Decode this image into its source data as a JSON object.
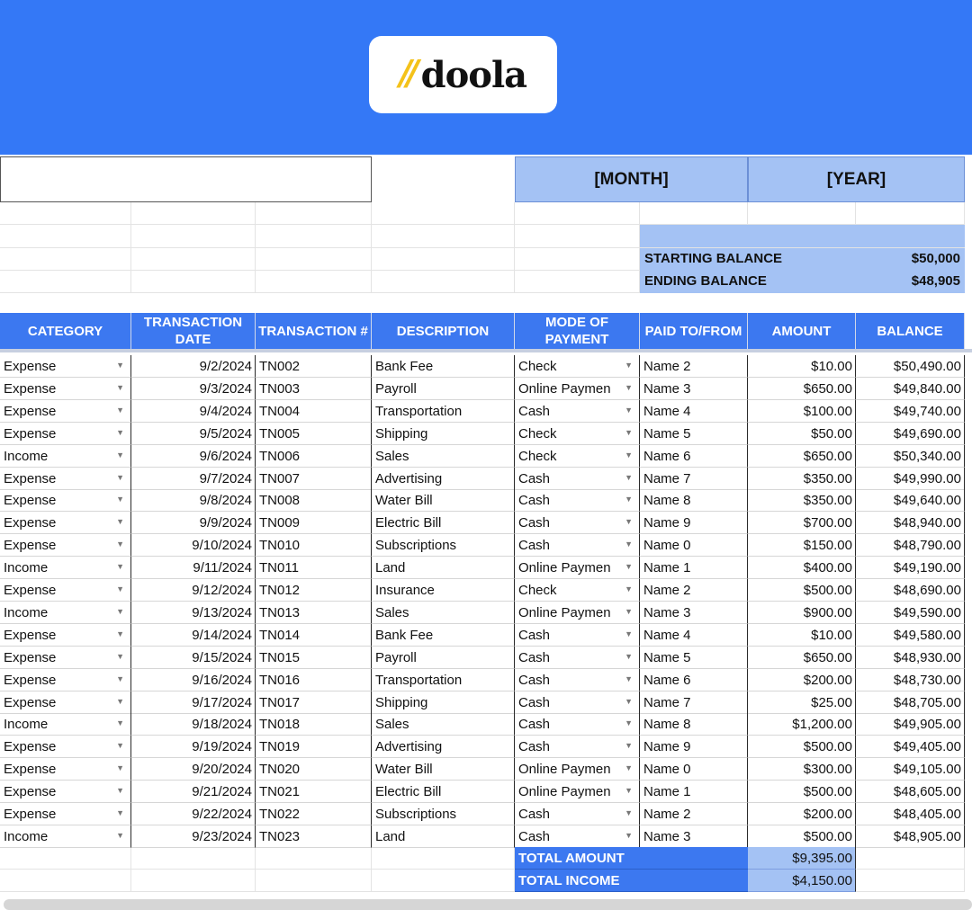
{
  "logo": {
    "slash": "//",
    "name": "doola"
  },
  "header": {
    "month_label": "[MONTH]",
    "year_label": "[YEAR]"
  },
  "balance": {
    "starting_label": "STARTING BALANCE",
    "starting_value": "$50,000",
    "ending_label": "ENDING BALANCE",
    "ending_value": "$48,905"
  },
  "columns": [
    "CATEGORY",
    "TRANSACTION DATE",
    "TRANSACTION #",
    "DESCRIPTION",
    "MODE OF PAYMENT",
    "PAID TO/FROM",
    "AMOUNT",
    "BALANCE"
  ],
  "rows": [
    [
      "Expense",
      "9/2/2024",
      "TN002",
      "Bank Fee",
      "Check",
      "Name 2",
      "$10.00",
      "$50,490.00"
    ],
    [
      "Expense",
      "9/3/2024",
      "TN003",
      "Payroll",
      "Online Paymen",
      "Name 3",
      "$650.00",
      "$49,840.00"
    ],
    [
      "Expense",
      "9/4/2024",
      "TN004",
      "Transportation",
      "Cash",
      "Name 4",
      "$100.00",
      "$49,740.00"
    ],
    [
      "Expense",
      "9/5/2024",
      "TN005",
      "Shipping",
      "Check",
      "Name 5",
      "$50.00",
      "$49,690.00"
    ],
    [
      "Income",
      "9/6/2024",
      "TN006",
      "Sales",
      "Check",
      "Name 6",
      "$650.00",
      "$50,340.00"
    ],
    [
      "Expense",
      "9/7/2024",
      "TN007",
      "Advertising",
      "Cash",
      "Name 7",
      "$350.00",
      "$49,990.00"
    ],
    [
      "Expense",
      "9/8/2024",
      "TN008",
      "Water Bill",
      "Cash",
      "Name 8",
      "$350.00",
      "$49,640.00"
    ],
    [
      "Expense",
      "9/9/2024",
      "TN009",
      "Electric Bill",
      "Cash",
      "Name 9",
      "$700.00",
      "$48,940.00"
    ],
    [
      "Expense",
      "9/10/2024",
      "TN010",
      "Subscriptions",
      "Cash",
      "Name 0",
      "$150.00",
      "$48,790.00"
    ],
    [
      "Income",
      "9/11/2024",
      "TN011",
      "Land",
      "Online Paymen",
      "Name 1",
      "$400.00",
      "$49,190.00"
    ],
    [
      "Expense",
      "9/12/2024",
      "TN012",
      "Insurance",
      "Check",
      "Name 2",
      "$500.00",
      "$48,690.00"
    ],
    [
      "Income",
      "9/13/2024",
      "TN013",
      "Sales",
      "Online Paymen",
      "Name 3",
      "$900.00",
      "$49,590.00"
    ],
    [
      "Expense",
      "9/14/2024",
      "TN014",
      "Bank Fee",
      "Cash",
      "Name 4",
      "$10.00",
      "$49,580.00"
    ],
    [
      "Expense",
      "9/15/2024",
      "TN015",
      "Payroll",
      "Cash",
      "Name 5",
      "$650.00",
      "$48,930.00"
    ],
    [
      "Expense",
      "9/16/2024",
      "TN016",
      "Transportation",
      "Cash",
      "Name 6",
      "$200.00",
      "$48,730.00"
    ],
    [
      "Expense",
      "9/17/2024",
      "TN017",
      "Shipping",
      "Cash",
      "Name 7",
      "$25.00",
      "$48,705.00"
    ],
    [
      "Income",
      "9/18/2024",
      "TN018",
      "Sales",
      "Cash",
      "Name 8",
      "$1,200.00",
      "$49,905.00"
    ],
    [
      "Expense",
      "9/19/2024",
      "TN019",
      "Advertising",
      "Cash",
      "Name 9",
      "$500.00",
      "$49,405.00"
    ],
    [
      "Expense",
      "9/20/2024",
      "TN020",
      "Water Bill",
      "Online Paymen",
      "Name 0",
      "$300.00",
      "$49,105.00"
    ],
    [
      "Expense",
      "9/21/2024",
      "TN021",
      "Electric Bill",
      "Online Paymen",
      "Name 1",
      "$500.00",
      "$48,605.00"
    ],
    [
      "Expense",
      "9/22/2024",
      "TN022",
      "Subscriptions",
      "Cash",
      "Name 2",
      "$200.00",
      "$48,405.00"
    ],
    [
      "Income",
      "9/23/2024",
      "TN023",
      "Land",
      "Cash",
      "Name 3",
      "$500.00",
      "$48,905.00"
    ]
  ],
  "totals": [
    {
      "label": "TOTAL AMOUNT",
      "value": "$9,395.00"
    },
    {
      "label": "TOTAL INCOME",
      "value": "$4,150.00"
    }
  ],
  "colors": {
    "banner": "#3478f6",
    "header": "#3c78f0",
    "light_blue": "#a4c2f4",
    "logo_slash": "#f4c21a"
  },
  "icons": {
    "dropdown": "dropdown-arrow-icon"
  }
}
